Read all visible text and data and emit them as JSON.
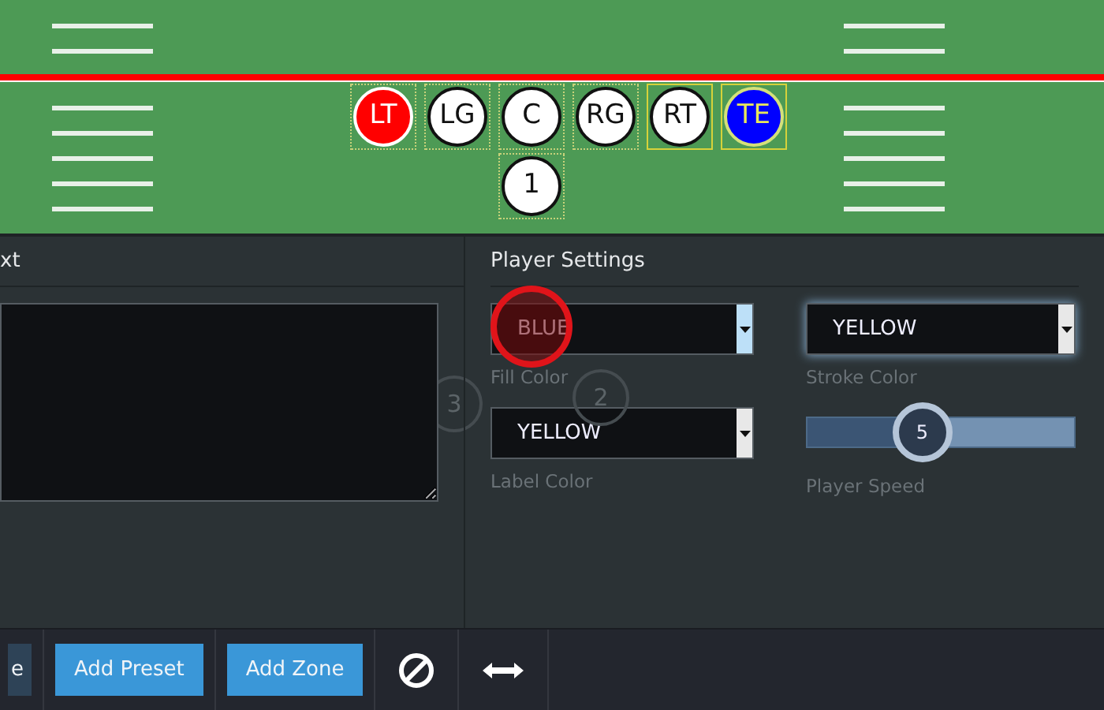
{
  "field": {
    "line_players": [
      {
        "label": "LT",
        "color": "#ff0000",
        "kind": "light",
        "selected": false
      },
      {
        "label": "LG",
        "color": "#ffffff",
        "kind": "dark",
        "selected": false
      },
      {
        "label": "C",
        "color": "#ffffff",
        "kind": "dark",
        "selected": false
      },
      {
        "label": "RG",
        "color": "#ffffff",
        "kind": "dark",
        "selected": false
      },
      {
        "label": "RT",
        "color": "#ffffff",
        "kind": "dark",
        "selected": true
      },
      {
        "label": "TE",
        "color": "#0000ff",
        "kind": "gold",
        "selected": true
      }
    ],
    "backfield": [
      {
        "label": "1",
        "color": "#ffffff",
        "kind": "dark",
        "selected": false
      }
    ]
  },
  "text_panel": {
    "title": "xt"
  },
  "ghost_players": [
    {
      "label": "3"
    },
    {
      "label": "2"
    }
  ],
  "player_settings": {
    "title": "Player Settings",
    "fill": {
      "value": "BLUE",
      "label": "Fill Color",
      "focused": false,
      "highlighted": true
    },
    "stroke": {
      "value": "YELLOW",
      "label": "Stroke Color",
      "focused": true
    },
    "label_color": {
      "value": "YELLOW",
      "label": "Label Color",
      "focused": false
    },
    "speed": {
      "value": "5",
      "level": 0.43,
      "label": "Player Speed"
    }
  },
  "toolbar": [
    {
      "kind": "button",
      "label": "e",
      "primary": false
    },
    {
      "kind": "button",
      "label": "Add Preset",
      "primary": true
    },
    {
      "kind": "button",
      "label": "Add Zone",
      "primary": true
    },
    {
      "kind": "ban"
    },
    {
      "kind": "arrows"
    }
  ]
}
